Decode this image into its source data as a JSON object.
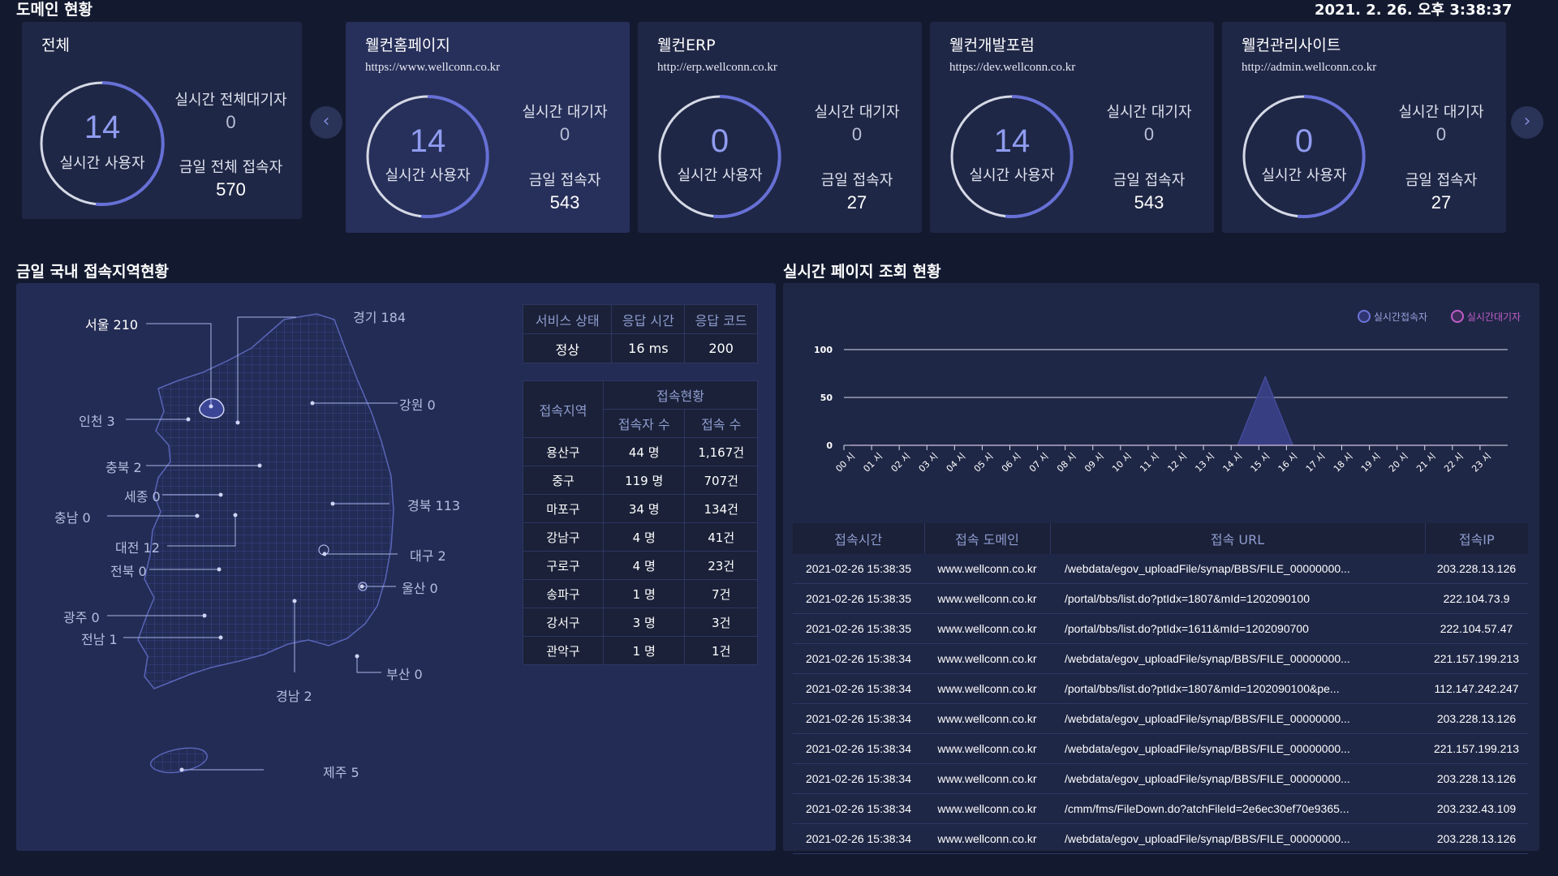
{
  "header": {
    "domain_status_title": "도메인 현황",
    "datetime": "2021. 2. 26. 오후 3:38:37"
  },
  "total_card": {
    "name": "전체",
    "gauge_value": "14",
    "gauge_label": "실시간 사용자",
    "waiting_label": "실시간 전체대기자",
    "waiting_value": "0",
    "today_label": "금일 전체 접속자",
    "today_value": "570"
  },
  "domains": [
    {
      "name": "웰컨홈페이지",
      "url": "https://www.wellconn.co.kr",
      "gauge_value": "14",
      "gauge_label": "실시간 사용자",
      "waiting_label": "실시간 대기자",
      "waiting_value": "0",
      "today_label": "금일 접속자",
      "today_value": "543"
    },
    {
      "name": "웰컨ERP",
      "url": "http://erp.wellconn.co.kr",
      "gauge_value": "0",
      "gauge_label": "실시간 사용자",
      "waiting_label": "실시간 대기자",
      "waiting_value": "0",
      "today_label": "금일 접속자",
      "today_value": "27"
    },
    {
      "name": "웰컨개발포럼",
      "url": "https://dev.wellconn.co.kr",
      "gauge_value": "14",
      "gauge_label": "실시간 사용자",
      "waiting_label": "실시간 대기자",
      "waiting_value": "0",
      "today_label": "금일 접속자",
      "today_value": "543"
    },
    {
      "name": "웰컨관리사이트",
      "url": "http://admin.wellconn.co.kr",
      "gauge_value": "0",
      "gauge_label": "실시간 사용자",
      "waiting_label": "실시간 대기자",
      "waiting_value": "0",
      "today_label": "금일 접속자",
      "today_value": "27"
    }
  ],
  "nav": {
    "prev_icon": "chevron-left-icon",
    "next_icon": "chevron-right-icon"
  },
  "region_section": {
    "title": "금일 국내 접속지역현황",
    "map_labels": {
      "seoul": "서울 210",
      "gyeonggi": "경기 184",
      "gangwon": "강원 0",
      "incheon": "인천 3",
      "chungbuk": "충북 2",
      "sejong": "세종 0",
      "chungnam": "충남 0",
      "gyeongbuk": "경북 113",
      "daejeon": "대전 12",
      "daegu": "대구 2",
      "jeonbuk": "전북 0",
      "ulsan": "울산 0",
      "gwangju": "광주 0",
      "jeonnam": "전남 1",
      "busan": "부산 0",
      "gyeongnam": "경남 2",
      "jeju": "제주 5"
    },
    "service": {
      "headers": [
        "서비스 상태",
        "응답 시간",
        "응답 코드"
      ],
      "values": [
        "정상",
        "16 ms",
        "200"
      ]
    },
    "region_table": {
      "h_region": "접속지역",
      "h_group": "접속현황",
      "h_users": "접속자 수",
      "h_hits": "접속 수",
      "rows": [
        [
          "용산구",
          "44 명",
          "1,167건"
        ],
        [
          "중구",
          "119 명",
          "707건"
        ],
        [
          "마포구",
          "34 명",
          "134건"
        ],
        [
          "강남구",
          "4 명",
          "41건"
        ],
        [
          "구로구",
          "4 명",
          "23건"
        ],
        [
          "송파구",
          "1 명",
          "7건"
        ],
        [
          "강서구",
          "3 명",
          "3건"
        ],
        [
          "관악구",
          "1 명",
          "1건"
        ]
      ]
    }
  },
  "pageview_section": {
    "title": "실시간 페이지 조회 현황",
    "legend": [
      {
        "label": "실시간접속자",
        "color": "#6c74d8"
      },
      {
        "label": "실시간대기자",
        "color": "#c05dc8"
      }
    ]
  },
  "chart_data": {
    "type": "area",
    "categories": [
      "00 시",
      "01 시",
      "02 시",
      "03 시",
      "04 시",
      "05 시",
      "06 시",
      "07 시",
      "08 시",
      "09 시",
      "10 시",
      "11 시",
      "12 시",
      "13 시",
      "14 시",
      "15 시",
      "16 시",
      "17 시",
      "18 시",
      "19 시",
      "20 시",
      "21 시",
      "22 시",
      "23 시"
    ],
    "yticks": [
      "0",
      "50",
      "100"
    ],
    "ylim": [
      0,
      100
    ],
    "series": [
      {
        "name": "실시간접속자",
        "values": [
          0,
          0,
          0,
          0,
          0,
          0,
          0,
          0,
          0,
          0,
          0,
          0,
          0,
          0,
          0,
          72,
          0,
          0,
          0,
          0,
          0,
          0,
          0,
          0
        ]
      },
      {
        "name": "실시간대기자",
        "values": [
          0,
          0,
          0,
          0,
          0,
          0,
          0,
          0,
          0,
          0,
          0,
          0,
          0,
          0,
          0,
          0,
          0,
          0,
          0,
          0,
          0,
          0,
          0,
          0
        ]
      }
    ]
  },
  "log_table": {
    "headers": [
      "접속시간",
      "접속 도메인",
      "접속 URL",
      "접속IP"
    ],
    "rows": [
      [
        "2021-02-26 15:38:35",
        "www.wellconn.co.kr",
        "/webdata/egov_uploadFile/synap/BBS/FILE_00000000...",
        "203.228.13.126"
      ],
      [
        "2021-02-26 15:38:35",
        "www.wellconn.co.kr",
        "/portal/bbs/list.do?ptIdx=1807&mId=1202090100",
        "222.104.73.9"
      ],
      [
        "2021-02-26 15:38:35",
        "www.wellconn.co.kr",
        "/portal/bbs/list.do?ptIdx=1611&mId=1202090700",
        "222.104.57.47"
      ],
      [
        "2021-02-26 15:38:34",
        "www.wellconn.co.kr",
        "/webdata/egov_uploadFile/synap/BBS/FILE_00000000...",
        "221.157.199.213"
      ],
      [
        "2021-02-26 15:38:34",
        "www.wellconn.co.kr",
        "/portal/bbs/list.do?ptIdx=1807&mId=1202090100&pe...",
        "112.147.242.247"
      ],
      [
        "2021-02-26 15:38:34",
        "www.wellconn.co.kr",
        "/webdata/egov_uploadFile/synap/BBS/FILE_00000000...",
        "203.228.13.126"
      ],
      [
        "2021-02-26 15:38:34",
        "www.wellconn.co.kr",
        "/webdata/egov_uploadFile/synap/BBS/FILE_00000000...",
        "221.157.199.213"
      ],
      [
        "2021-02-26 15:38:34",
        "www.wellconn.co.kr",
        "/webdata/egov_uploadFile/synap/BBS/FILE_00000000...",
        "203.228.13.126"
      ],
      [
        "2021-02-26 15:38:34",
        "www.wellconn.co.kr",
        "/cmm/fms/FileDown.do?atchFileId=2e6ec30ef70e9365...",
        "203.232.43.109"
      ],
      [
        "2021-02-26 15:38:34",
        "www.wellconn.co.kr",
        "/webdata/egov_uploadFile/synap/BBS/FILE_00000000...",
        "203.228.13.126"
      ]
    ]
  }
}
